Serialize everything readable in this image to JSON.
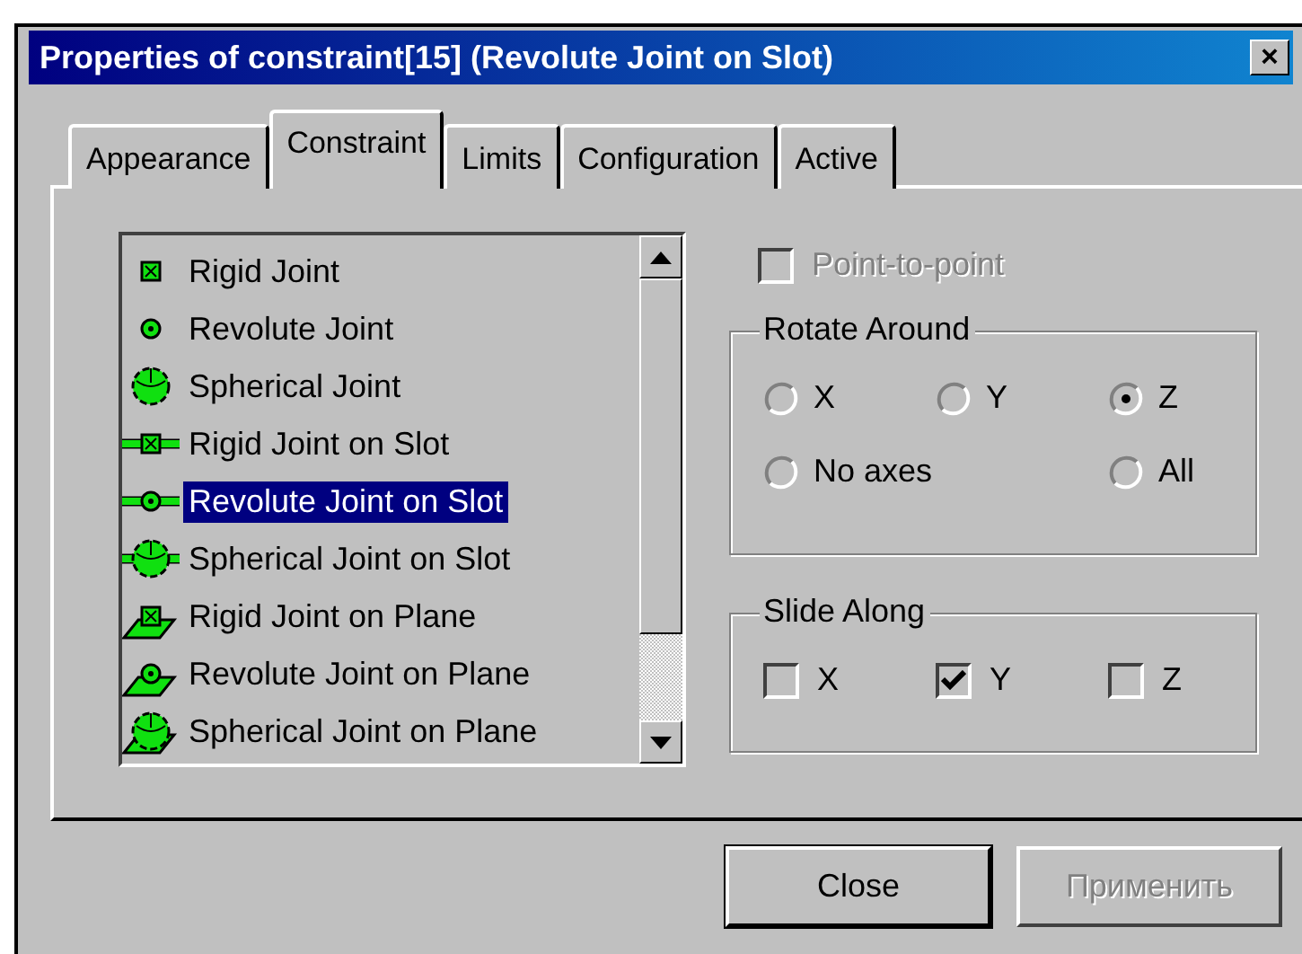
{
  "window": {
    "title": "Properties of constraint[15] (Revolute Joint on Slot)",
    "close": "×"
  },
  "tabs": [
    {
      "label": "Appearance",
      "selected": false
    },
    {
      "label": "Constraint",
      "selected": true
    },
    {
      "label": "Limits",
      "selected": false
    },
    {
      "label": "Configuration",
      "selected": false
    },
    {
      "label": "Active",
      "selected": false
    }
  ],
  "joint_list": {
    "items": [
      {
        "label": "Rigid Joint",
        "kind": "rigid",
        "selected": false
      },
      {
        "label": "Revolute Joint",
        "kind": "revolute",
        "selected": false
      },
      {
        "label": "Spherical Joint",
        "kind": "spherical",
        "selected": false
      },
      {
        "label": "Rigid Joint on Slot",
        "kind": "rigidslot",
        "selected": false
      },
      {
        "label": "Revolute Joint on Slot",
        "kind": "revoluteslot",
        "selected": true
      },
      {
        "label": "Spherical Joint on Slot",
        "kind": "sphericalslot",
        "selected": false
      },
      {
        "label": "Rigid Joint on Plane",
        "kind": "rigidplane",
        "selected": false
      },
      {
        "label": "Revolute Joint on Plane",
        "kind": "revoluteplane",
        "selected": false
      },
      {
        "label": "Spherical Joint on Plane",
        "kind": "sphericalplane",
        "selected": false
      }
    ]
  },
  "point_to_point": {
    "label": "Point-to-point",
    "checked": false,
    "disabled": true
  },
  "rotate_around": {
    "title": "Rotate Around",
    "options": [
      {
        "label": "X",
        "selected": false
      },
      {
        "label": "Y",
        "selected": false
      },
      {
        "label": "Z",
        "selected": true
      },
      {
        "label": "No axes",
        "selected": false
      },
      {
        "label": "All",
        "selected": false
      }
    ]
  },
  "slide_along": {
    "title": "Slide Along",
    "options": [
      {
        "label": "X",
        "checked": false
      },
      {
        "label": "Y",
        "checked": true
      },
      {
        "label": "Z",
        "checked": false
      }
    ]
  },
  "buttons": [
    {
      "label": "Close",
      "disabled": false,
      "default": true
    },
    {
      "label": "Применить",
      "disabled": true,
      "default": false
    }
  ]
}
